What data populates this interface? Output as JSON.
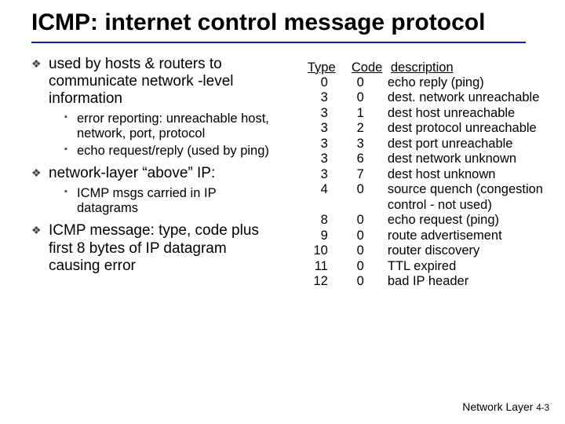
{
  "title": "ICMP: internet control message protocol",
  "left": {
    "items": [
      {
        "text": "used by hosts & routers to communicate network -level information",
        "sub": [
          "error reporting: unreachable host, network, port, protocol",
          "echo request/reply (used by ping)"
        ]
      },
      {
        "text": "network-layer “above” IP:",
        "sub": [
          "ICMP msgs carried in IP datagrams"
        ]
      },
      {
        "text": "ICMP message: type, code plus first 8 bytes of IP datagram causing error",
        "sub": []
      }
    ]
  },
  "table": {
    "headers": {
      "type": "Type",
      "code": "Code",
      "desc": "description"
    },
    "rows": [
      {
        "type": "0",
        "code": "0",
        "desc": "echo reply (ping)"
      },
      {
        "type": "3",
        "code": "0",
        "desc": "dest. network unreachable"
      },
      {
        "type": "3",
        "code": "1",
        "desc": "dest host unreachable"
      },
      {
        "type": "3",
        "code": "2",
        "desc": "dest protocol unreachable"
      },
      {
        "type": "3",
        "code": "3",
        "desc": "dest port unreachable"
      },
      {
        "type": "3",
        "code": "6",
        "desc": "dest network unknown"
      },
      {
        "type": "3",
        "code": "7",
        "desc": "dest host unknown"
      },
      {
        "type": "4",
        "code": "0",
        "desc": "source quench (congestion"
      },
      {
        "type": "",
        "code": "",
        "desc": "control - not used)"
      },
      {
        "type": "8",
        "code": "0",
        "desc": "echo request (ping)"
      },
      {
        "type": "9",
        "code": "0",
        "desc": "route advertisement"
      },
      {
        "type": "10",
        "code": "0",
        "desc": "     router discovery"
      },
      {
        "type": "11",
        "code": "0",
        "desc": "        TTL expired"
      },
      {
        "type": "12",
        "code": "0",
        "desc": "     bad IP header"
      }
    ]
  },
  "footer": {
    "label": "Network Layer",
    "page": "4-3"
  }
}
